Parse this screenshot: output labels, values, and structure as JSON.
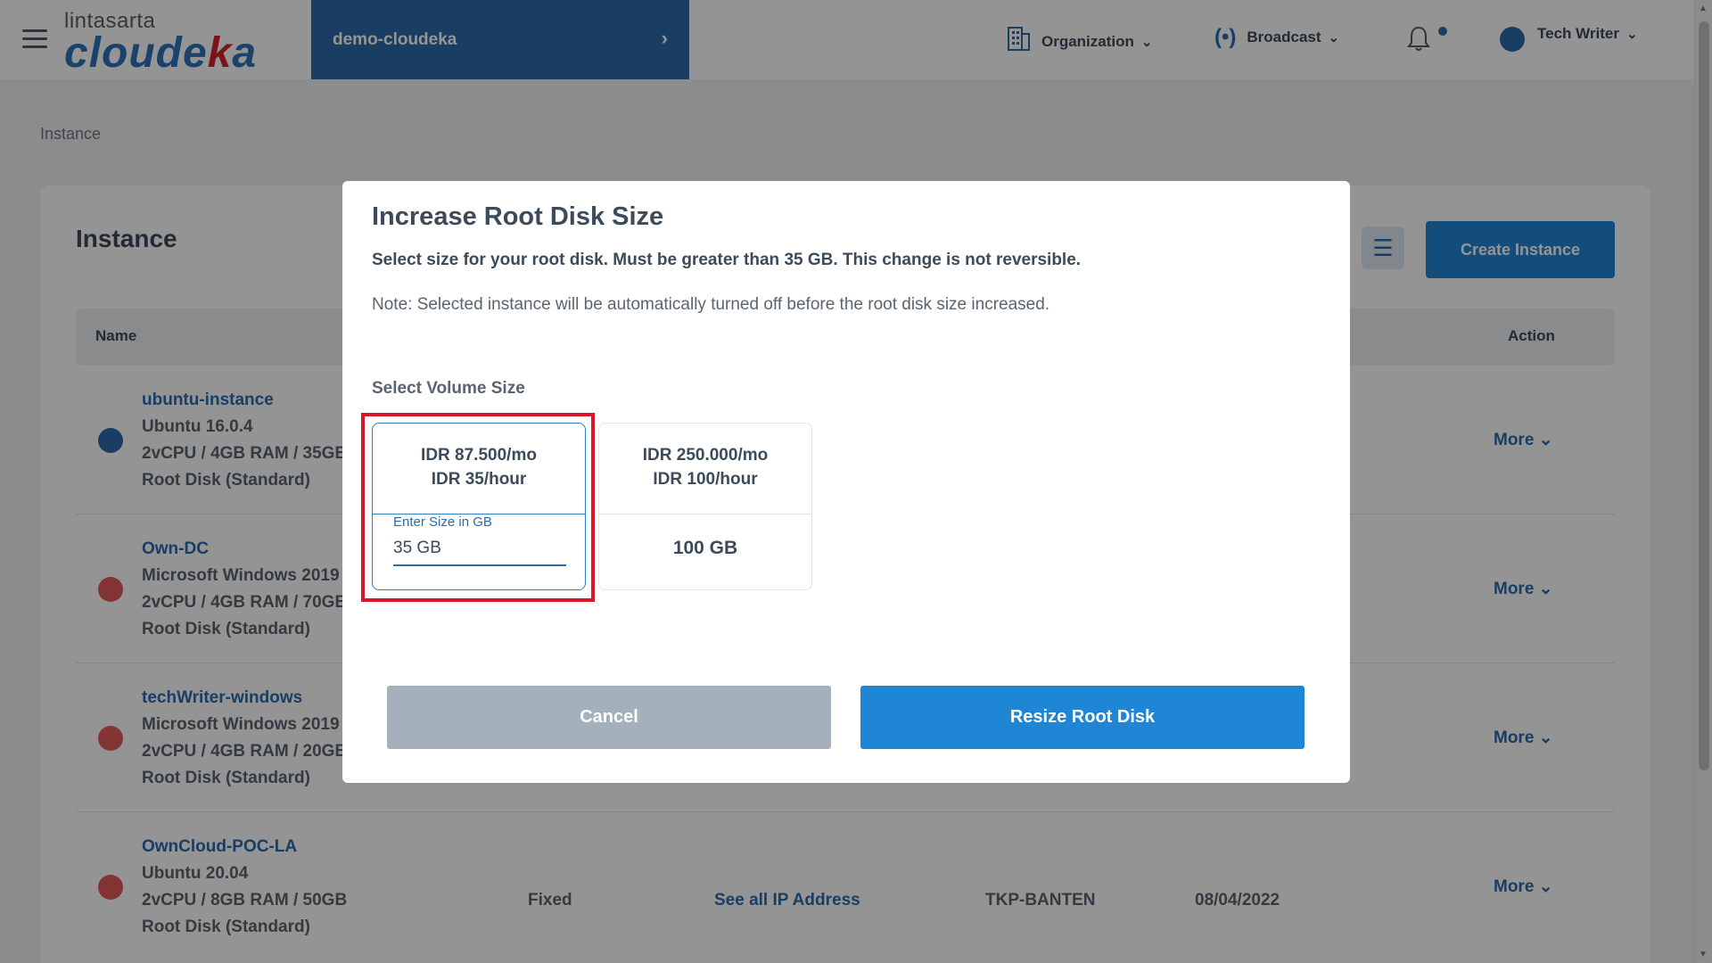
{
  "header": {
    "logo_small": "lintasarta",
    "logo_big_a": "cloude",
    "logo_big_k": "k",
    "logo_big_b": "a",
    "project": "demo-cloudeka",
    "organization": "Organization",
    "broadcast": "Broadcast",
    "user": "Tech Writer"
  },
  "page": {
    "breadcrumb": "Instance",
    "title": "Instance",
    "create_button": "Create Instance",
    "col_name": "Name",
    "col_action": "Action",
    "more_label": "More",
    "rows": [
      {
        "title": "ubuntu-instance",
        "os": "Ubuntu 16.0.4",
        "spec": "2vCPU / 4GB RAM / 35GB",
        "disk": "Root Disk (Standard)",
        "status_color": "#2c6aab"
      },
      {
        "title": "Own-DC",
        "os": "Microsoft Windows 2019",
        "spec": "2vCPU / 4GB RAM / 70GB",
        "disk": "Root Disk (Standard)",
        "status_color": "#e2595a"
      },
      {
        "title": "techWriter-windows",
        "os": "Microsoft Windows 2019",
        "spec": "2vCPU / 4GB RAM / 20GB",
        "disk": "Root Disk (Standard)",
        "status_color": "#e2595a"
      },
      {
        "title": "OwnCloud-POC-LA",
        "os": "Ubuntu 20.04",
        "spec": "2vCPU / 8GB RAM / 50GB",
        "disk": "Root Disk (Standard)",
        "status_color": "#e2595a",
        "ip_type": "Fixed",
        "ip_link": "See all IP Address",
        "zone": "TKP-BANTEN",
        "date": "08/04/2022"
      }
    ]
  },
  "modal": {
    "title": "Increase Root Disk Size",
    "subtitle": "Select size for your root disk. Must be greater than 35 GB. This change is not reversible.",
    "note": "Note: Selected instance will be automatically turned off before the root disk size increased.",
    "volume_label": "Select Volume Size",
    "options": [
      {
        "price_month": "IDR 87.500/mo",
        "price_hour": "IDR 35/hour",
        "input_label": "Enter Size in GB",
        "input_value": "35 GB",
        "selected": true
      },
      {
        "price_month": "IDR 250.000/mo",
        "price_hour": "IDR 100/hour",
        "size": "100 GB",
        "selected": false
      }
    ],
    "cancel": "Cancel",
    "resize": "Resize Root Disk"
  },
  "colors": {
    "primary": "#1f86d6",
    "brand": "#2c6aab",
    "highlight": "#d7182a",
    "status_off": "#e2595a"
  }
}
